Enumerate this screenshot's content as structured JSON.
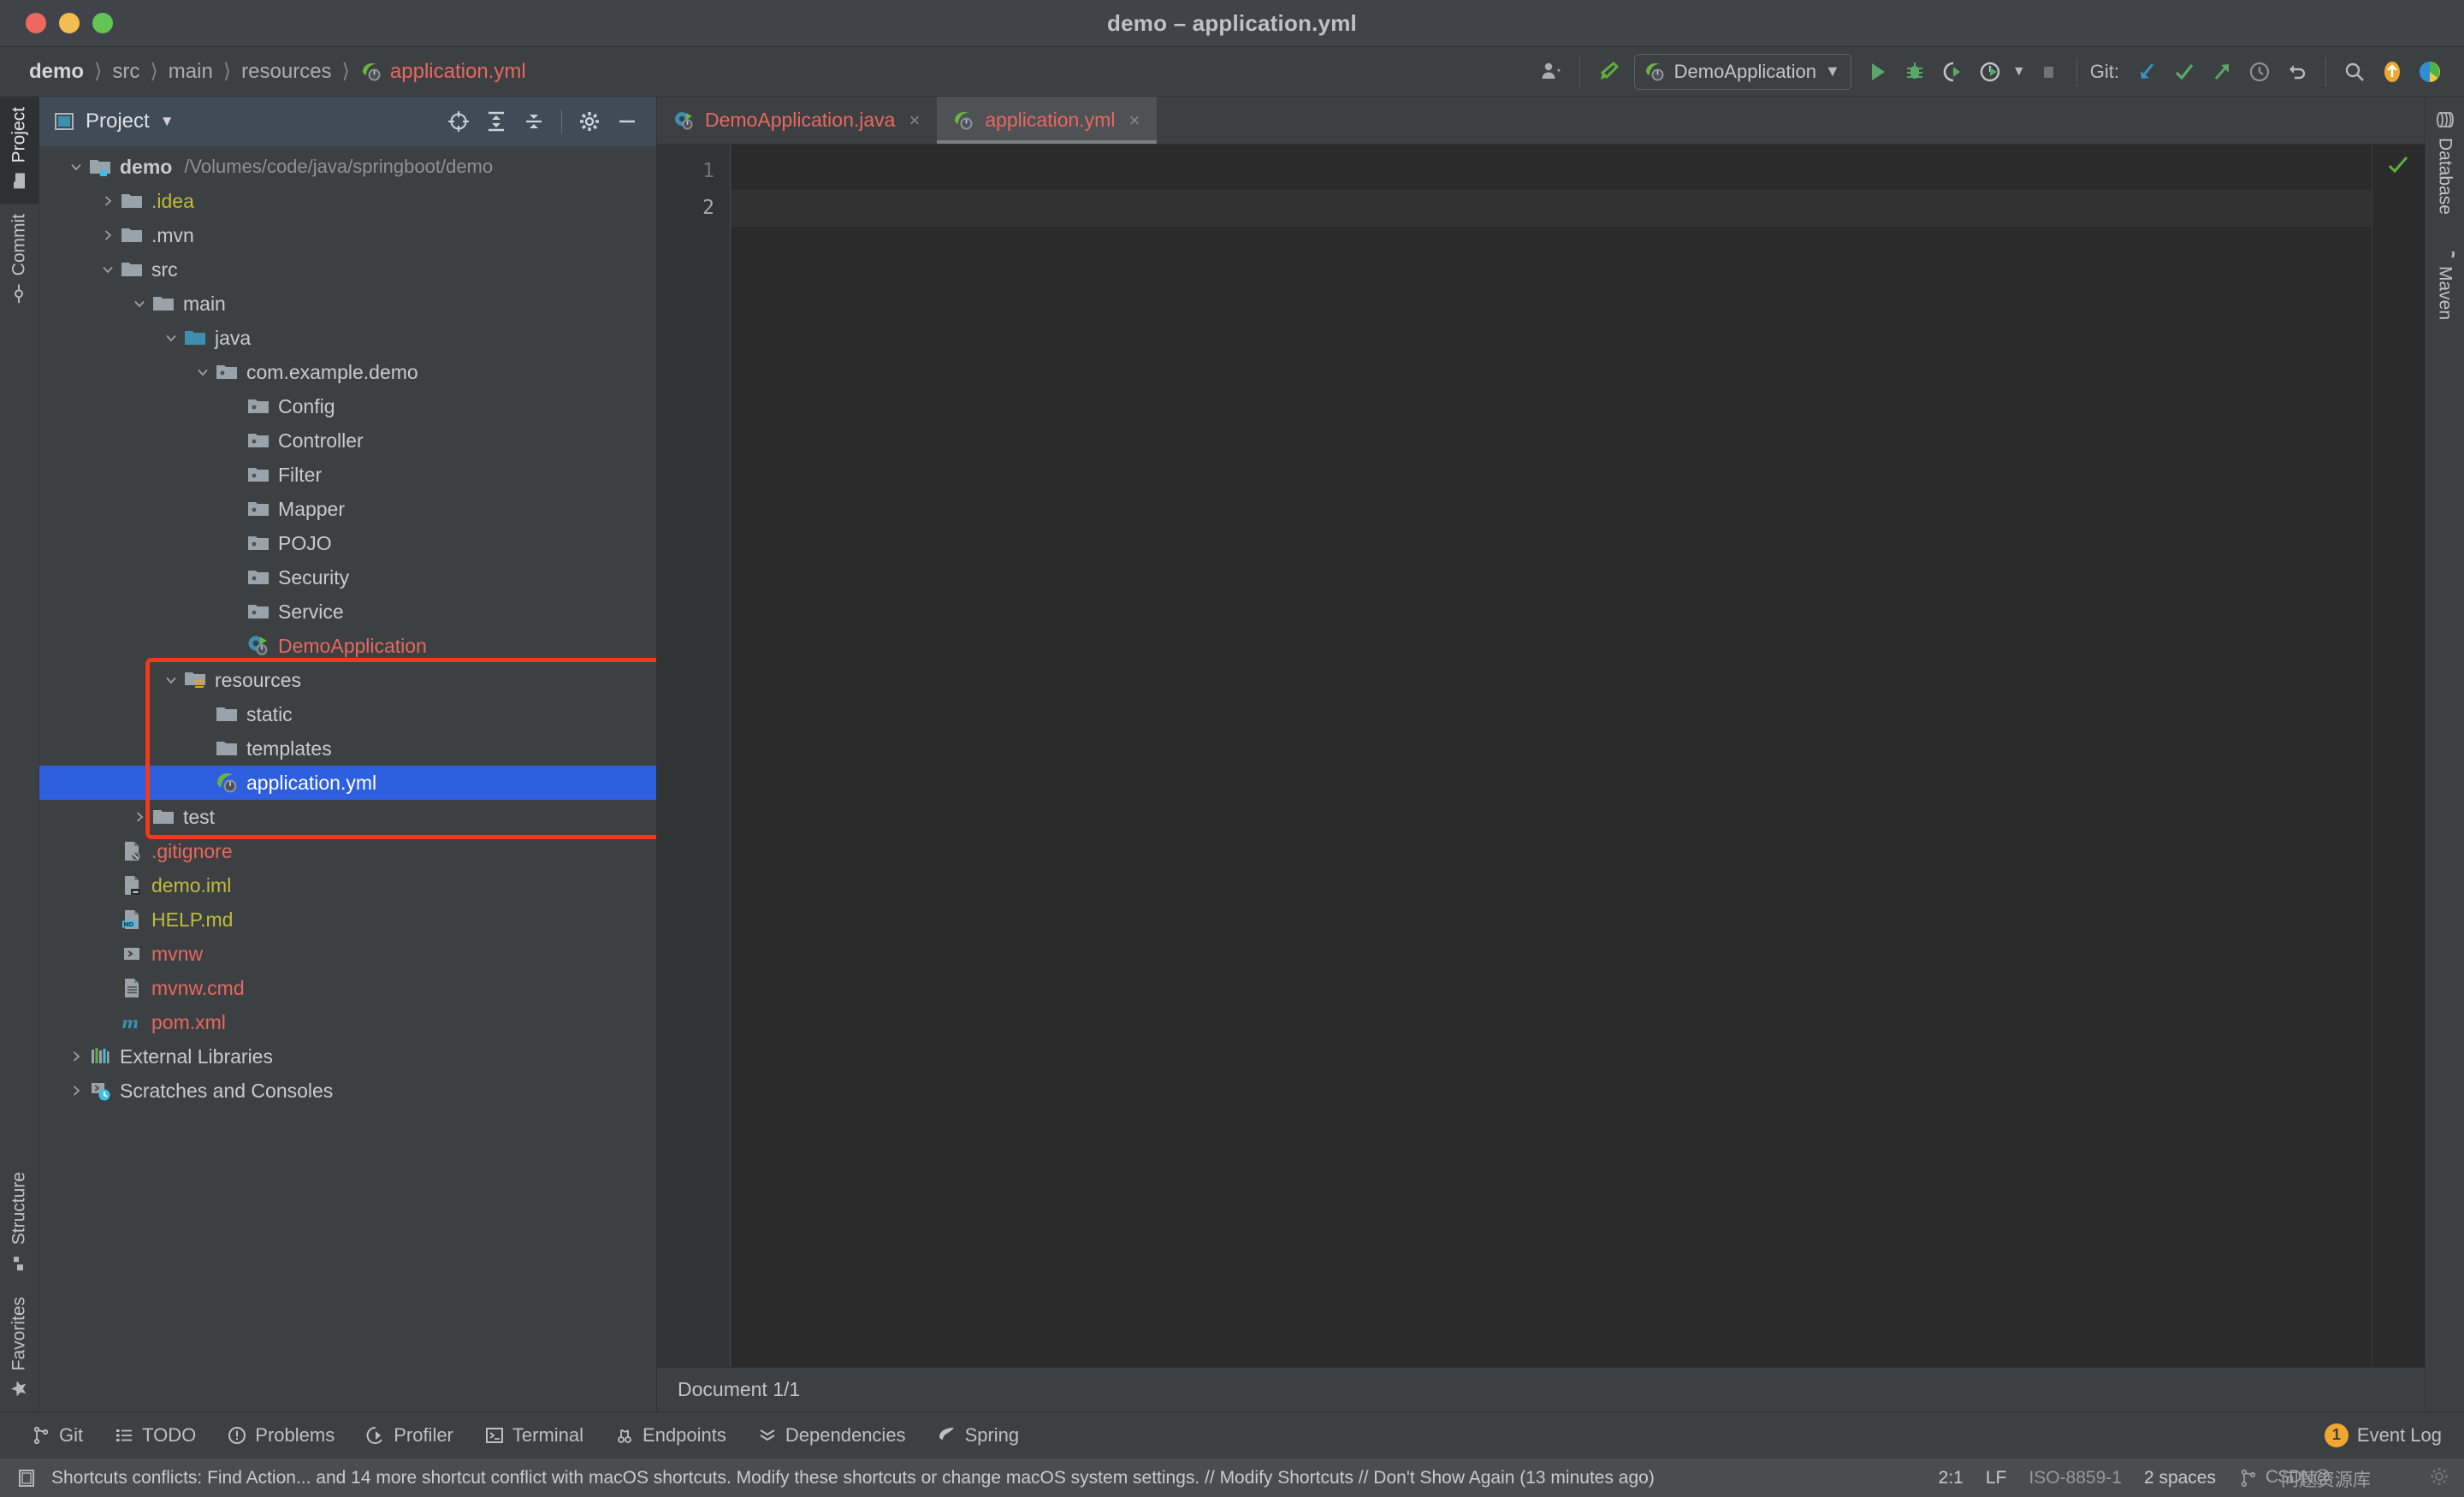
{
  "window": {
    "title": "demo – application.yml",
    "traffic_lights": [
      "close",
      "minimize",
      "maximize"
    ]
  },
  "breadcrumb": {
    "items": [
      "demo",
      "src",
      "main",
      "resources",
      "application.yml"
    ],
    "separator": "〉"
  },
  "toolbar": {
    "run_config": "DemoApplication",
    "git_label": "Git:",
    "buttons": [
      "account-icon",
      "build-icon",
      "run-icon",
      "debug-icon",
      "run-coverage-icon",
      "profile-icon",
      "stop-icon"
    ],
    "git_buttons": [
      "update-project-icon",
      "commit-icon",
      "push-icon",
      "history-icon",
      "rollback-icon"
    ],
    "right_buttons": [
      "search-everywhere-icon",
      "updates-icon",
      "ide-icon"
    ]
  },
  "left_rail": {
    "top": [
      {
        "label": "Project",
        "icon": "project-folder-icon",
        "active": true
      },
      {
        "label": "Commit",
        "icon": "commit-icon",
        "active": false
      }
    ],
    "bottom": [
      {
        "label": "Structure",
        "icon": "structure-icon",
        "active": false
      },
      {
        "label": "Favorites",
        "icon": "star-icon",
        "active": false
      }
    ]
  },
  "right_rail": {
    "items": [
      {
        "label": "Database",
        "icon": "database-icon"
      },
      {
        "label": "Maven",
        "icon": "maven-icon"
      }
    ]
  },
  "project_panel": {
    "title": "Project",
    "title_dropdown": "▾",
    "header_buttons": [
      "select-opened-file-icon",
      "expand-all-icon",
      "collapse-all-icon",
      "settings-gear-icon",
      "hide-icon"
    ],
    "tree": [
      {
        "indent": 0,
        "twisty": "down",
        "icon": "module-folder-icon",
        "label": "demo",
        "path": "/Volumes/code/java/springboot/demo",
        "color": "white",
        "bold": true
      },
      {
        "indent": 1,
        "twisty": "right",
        "icon": "folder-icon",
        "label": ".idea",
        "color": "yellow"
      },
      {
        "indent": 1,
        "twisty": "right",
        "icon": "folder-icon",
        "label": ".mvn",
        "color": "white"
      },
      {
        "indent": 1,
        "twisty": "down",
        "icon": "folder-icon",
        "label": "src",
        "color": "white"
      },
      {
        "indent": 2,
        "twisty": "down",
        "icon": "folder-icon",
        "label": "main",
        "color": "white"
      },
      {
        "indent": 3,
        "twisty": "down",
        "icon": "source-root-icon",
        "label": "java",
        "color": "white"
      },
      {
        "indent": 4,
        "twisty": "down",
        "icon": "package-icon",
        "label": "com.example.demo",
        "color": "white"
      },
      {
        "indent": 5,
        "twisty": "none",
        "icon": "package-icon",
        "label": "Config",
        "color": "white"
      },
      {
        "indent": 5,
        "twisty": "none",
        "icon": "package-icon",
        "label": "Controller",
        "color": "white"
      },
      {
        "indent": 5,
        "twisty": "none",
        "icon": "package-icon",
        "label": "Filter",
        "color": "white"
      },
      {
        "indent": 5,
        "twisty": "none",
        "icon": "package-icon",
        "label": "Mapper",
        "color": "white"
      },
      {
        "indent": 5,
        "twisty": "none",
        "icon": "package-icon",
        "label": "POJO",
        "color": "white"
      },
      {
        "indent": 5,
        "twisty": "none",
        "icon": "package-icon",
        "label": "Security",
        "color": "white"
      },
      {
        "indent": 5,
        "twisty": "none",
        "icon": "package-icon",
        "label": "Service",
        "color": "white"
      },
      {
        "indent": 5,
        "twisty": "none",
        "icon": "spring-class-icon",
        "label": "DemoApplication",
        "color": "red"
      },
      {
        "indent": 3,
        "twisty": "down",
        "icon": "resource-root-icon",
        "label": "resources",
        "color": "white"
      },
      {
        "indent": 4,
        "twisty": "none",
        "icon": "folder-icon",
        "label": "static",
        "color": "white"
      },
      {
        "indent": 4,
        "twisty": "none",
        "icon": "folder-icon",
        "label": "templates",
        "color": "white"
      },
      {
        "indent": 4,
        "twisty": "none",
        "icon": "spring-yml-icon",
        "label": "application.yml",
        "color": "white",
        "selected": true
      },
      {
        "indent": 2,
        "twisty": "right",
        "icon": "folder-icon",
        "label": "test",
        "color": "white"
      },
      {
        "indent": 1,
        "twisty": "none",
        "icon": "gitignore-icon",
        "label": ".gitignore",
        "color": "red"
      },
      {
        "indent": 1,
        "twisty": "none",
        "icon": "iml-icon",
        "label": "demo.iml",
        "color": "yellow"
      },
      {
        "indent": 1,
        "twisty": "none",
        "icon": "markdown-icon",
        "label": "HELP.md",
        "color": "yellow"
      },
      {
        "indent": 1,
        "twisty": "none",
        "icon": "shell-icon",
        "label": "mvnw",
        "color": "red"
      },
      {
        "indent": 1,
        "twisty": "none",
        "icon": "cmd-file-icon",
        "label": "mvnw.cmd",
        "color": "red"
      },
      {
        "indent": 1,
        "twisty": "none",
        "icon": "maven-pom-icon",
        "label": "pom.xml",
        "color": "red"
      },
      {
        "indent": 0,
        "twisty": "right",
        "icon": "libraries-icon",
        "label": "External Libraries",
        "color": "white"
      },
      {
        "indent": 0,
        "twisty": "right",
        "icon": "scratches-icon",
        "label": "Scratches and Consoles",
        "color": "white"
      }
    ]
  },
  "annotation": {
    "color": "#f03a1c",
    "highlights": [
      "resources",
      "static",
      "templates",
      "application.yml",
      "test"
    ]
  },
  "editor": {
    "tabs": [
      {
        "label": "DemoApplication.java",
        "icon": "spring-class-icon",
        "active": false,
        "close": "×"
      },
      {
        "label": "application.yml",
        "icon": "spring-yml-icon",
        "active": true,
        "close": "×"
      }
    ],
    "line_numbers": [
      "1",
      "2"
    ],
    "current_line": 2,
    "content_lines": [
      "",
      ""
    ],
    "inspection_status": "ok-check",
    "document_status": "Document 1/1"
  },
  "tool_window_bar": {
    "items": [
      {
        "label": "Git",
        "icon": "git-branch-icon"
      },
      {
        "label": "TODO",
        "icon": "todo-list-icon"
      },
      {
        "label": "Problems",
        "icon": "problems-icon"
      },
      {
        "label": "Profiler",
        "icon": "profiler-icon"
      },
      {
        "label": "Terminal",
        "icon": "terminal-icon"
      },
      {
        "label": "Endpoints",
        "icon": "endpoints-icon"
      },
      {
        "label": "Dependencies",
        "icon": "dependencies-icon"
      },
      {
        "label": "Spring",
        "icon": "spring-leaf-icon"
      }
    ],
    "event_log": {
      "label": "Event Log",
      "count": "1"
    }
  },
  "status_bar": {
    "message": "Shortcuts conflicts: Find Action... and 14 more shortcut conflict with macOS shortcuts. Modify these shortcuts or change macOS system settings. // Modify Shortcuts // Don't Show Again (13 minutes ago)",
    "caret_position": "2:1",
    "line_separator": "LF",
    "encoding": "ISO-8859-1",
    "indent": "2 spaces",
    "branch_icon": "git-branch-icon",
    "watermark_latin": "CSDN@",
    "watermark_cjk": "问题资源库"
  }
}
